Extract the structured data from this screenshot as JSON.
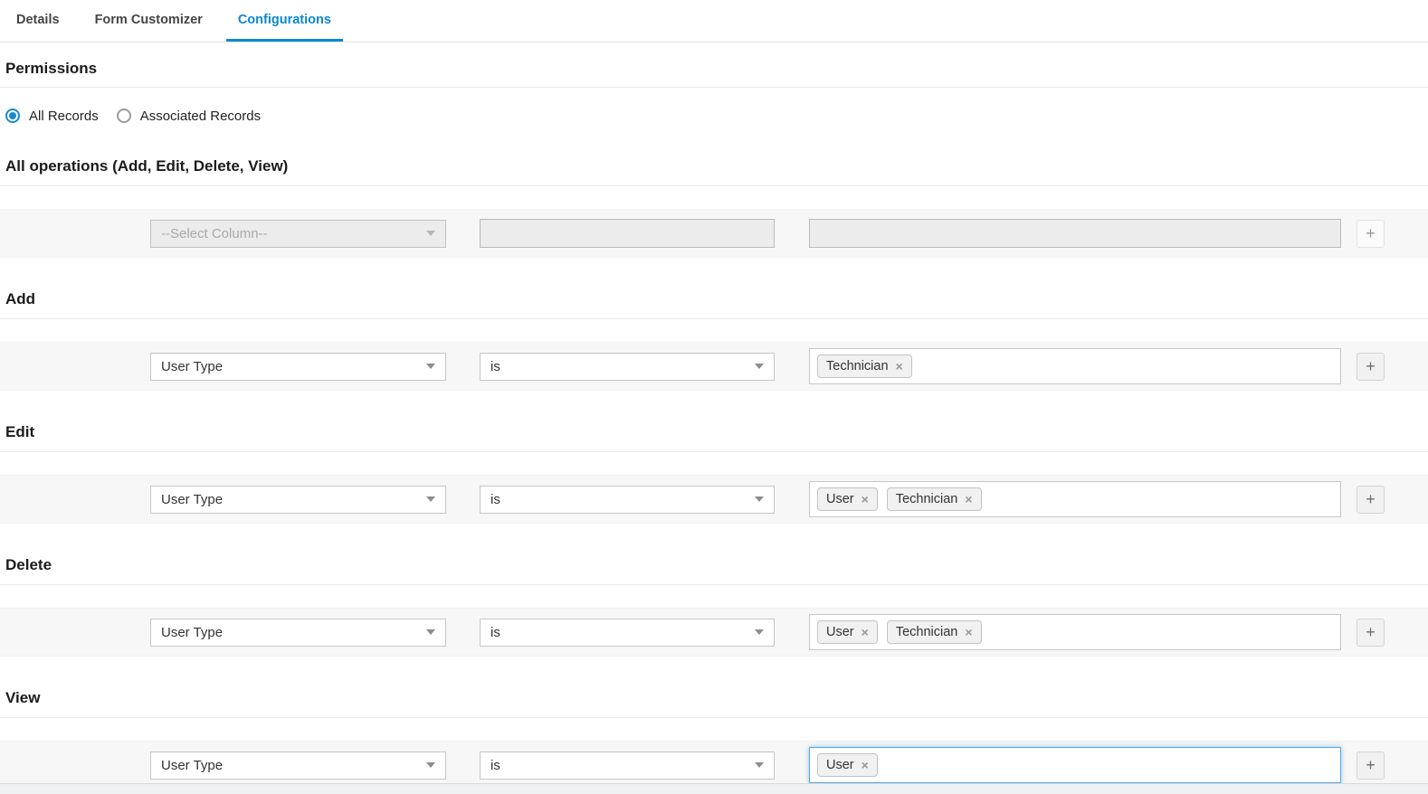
{
  "tabs": {
    "items": [
      {
        "label": "Details",
        "active": false
      },
      {
        "label": "Form Customizer",
        "active": false
      },
      {
        "label": "Configurations",
        "active": true
      }
    ]
  },
  "permissions": {
    "title": "Permissions",
    "scope_options": [
      {
        "label": "All Records",
        "selected": true
      },
      {
        "label": "Associated Records",
        "selected": false
      }
    ]
  },
  "criteria_sections": [
    {
      "id": "all-operations",
      "title": "All operations (Add, Edit, Delete, View)",
      "row": {
        "state": "disabled",
        "column_select": {
          "value": "--Select Column--",
          "is_placeholder": true
        },
        "condition_select": {
          "value": ""
        },
        "values": []
      }
    },
    {
      "id": "add",
      "title": "Add",
      "row": {
        "state": "default",
        "column_select": {
          "value": "User Type",
          "is_placeholder": false
        },
        "condition_select": {
          "value": "is"
        },
        "values": [
          "Technician"
        ]
      }
    },
    {
      "id": "edit",
      "title": "Edit",
      "row": {
        "state": "default",
        "column_select": {
          "value": "User Type",
          "is_placeholder": false
        },
        "condition_select": {
          "value": "is"
        },
        "values": [
          "User",
          "Technician"
        ]
      }
    },
    {
      "id": "delete",
      "title": "Delete",
      "row": {
        "state": "default",
        "column_select": {
          "value": "User Type",
          "is_placeholder": false
        },
        "condition_select": {
          "value": "is"
        },
        "values": [
          "User",
          "Technician"
        ]
      }
    },
    {
      "id": "view",
      "title": "View",
      "row": {
        "state": "focused",
        "column_select": {
          "value": "User Type",
          "is_placeholder": false
        },
        "condition_select": {
          "value": "is"
        },
        "values": [
          "User"
        ]
      }
    }
  ],
  "glyphs": {
    "add_button": "+",
    "tag_remove": "×",
    "chevron_down": "chevron-down-icon"
  },
  "colors": {
    "accent": "#0c87d1",
    "radio_selected": "#1889ce",
    "focus_border": "#57a8e5",
    "row_background": "#f7f7f7",
    "disabled_fill": "#ececec"
  }
}
